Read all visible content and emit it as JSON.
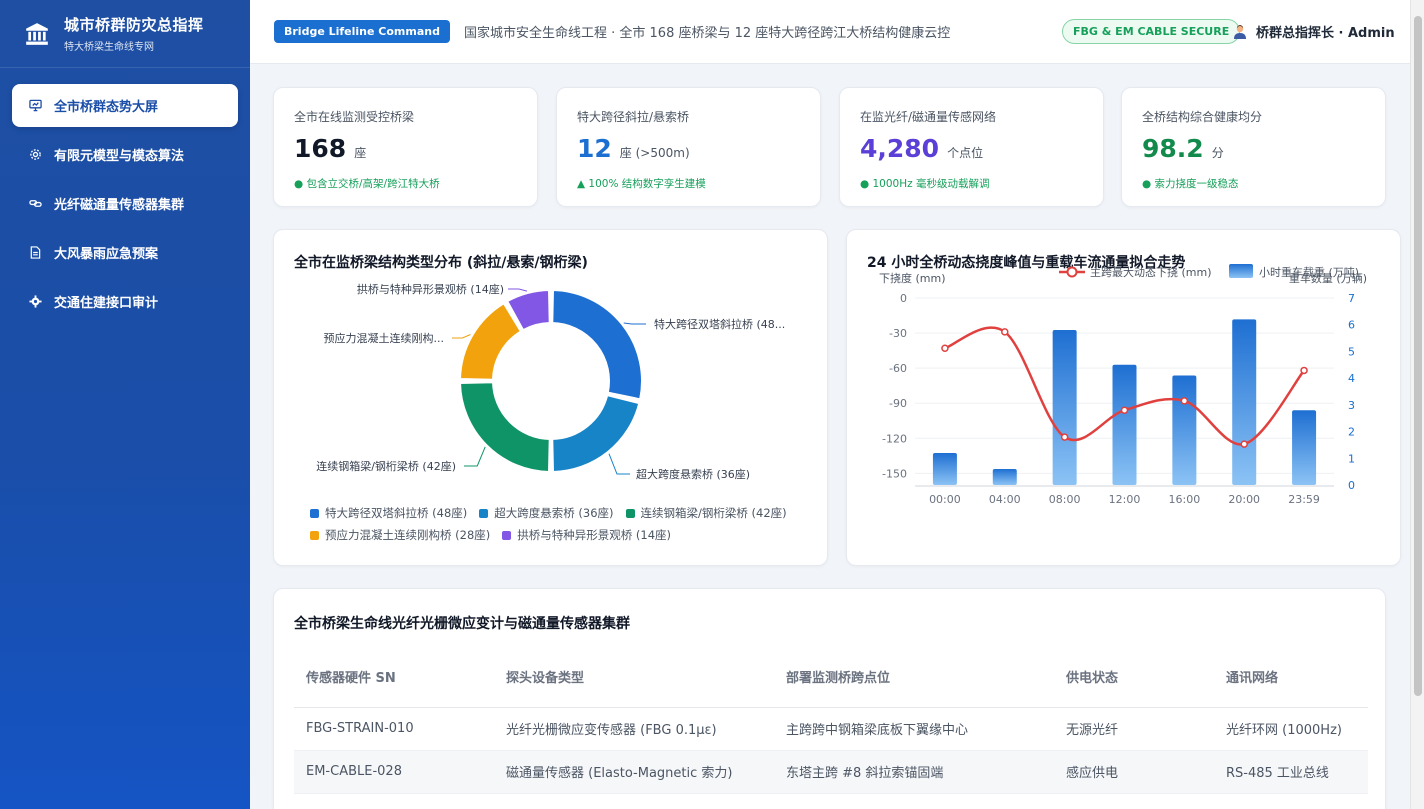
{
  "sidebar": {
    "title": "城市桥群防灾总指挥",
    "subtitle": "特大桥梁生命线专网",
    "items": [
      {
        "label": "全市桥群态势大屏",
        "icon": "dashboard-icon"
      },
      {
        "label": "有限元模型与模态算法",
        "icon": "cog-icon"
      },
      {
        "label": "光纤磁通量传感器集群",
        "icon": "link-icon"
      },
      {
        "label": "大风暴雨应急预案",
        "icon": "document-icon"
      },
      {
        "label": "交通住建接口审计",
        "icon": "gear-icon"
      }
    ]
  },
  "header": {
    "badge": "Bridge Lifeline Command",
    "description": "国家城市安全生命线工程 · 全市 168 座桥梁与 12 座特大跨径跨江大桥结构健康云控",
    "secure_badge": "FBG & EM CABLE SECURE",
    "user": "桥群总指挥长 · Admin"
  },
  "kpis": [
    {
      "label": "全市在线监测受控桥梁",
      "value": "168",
      "unit": "座",
      "foot": "● 包含立交桥/高架/跨江特大桥",
      "color": "#111827"
    },
    {
      "label": "特大跨径斜拉/悬索桥",
      "value": "12",
      "unit": "座 (>500m)",
      "foot": "▲ 100% 结构数字孪生建模",
      "color": "#1a6fd1"
    },
    {
      "label": "在监光纤/磁通量传感网络",
      "value": "4,280",
      "unit": "个点位",
      "foot": "● 1000Hz 毫秒级动载解调",
      "color": "#5b3fd6"
    },
    {
      "label": "全桥结构综合健康均分",
      "value": "98.2",
      "unit": "分",
      "foot": "● 索力挠度一级稳态",
      "color": "#128a4c"
    }
  ],
  "donut": {
    "title": "全市在监桥梁结构类型分布 (斜拉/悬索/钢桁梁)",
    "outer_labels": [
      "特大跨径双塔斜拉桥 (48...",
      "超大跨度悬索桥 (36座)",
      "连续钢箱梁/钢桁梁桥 (42座)",
      "预应力混凝土连续刚构...",
      "拱桥与特种异形景观桥 (14座)"
    ]
  },
  "line_chart": {
    "title": "24 小时全桥动态挠度峰值与重载车流通量拟合走势",
    "left_axis_label": "下挠度 (mm)",
    "right_axis_label": "重车数量 (万辆)",
    "legend_line": "主跨最大动态下挠 (mm)",
    "legend_bar": "小时重车载重 (万吨)"
  },
  "table": {
    "title": "全市桥梁生命线光纤光栅微应变计与磁通量传感器集群",
    "columns": [
      "传感器硬件 SN",
      "探头设备类型",
      "部署监测桥跨点位",
      "供电状态",
      "通讯网络"
    ],
    "rows": [
      [
        "FBG-STRAIN-010",
        "光纤光栅微应变传感器 (FBG 0.1με)",
        "主跨跨中钢箱梁底板下翼缘中心",
        "无源光纤",
        "光纤环网 (1000Hz)"
      ],
      [
        "EM-CABLE-028",
        "磁通量传感器 (Elasto-Magnetic 索力)",
        "东塔主跨 #8 斜拉索锚固端",
        "感应供电",
        "RS-485 工业总线"
      ]
    ]
  },
  "chart_data": [
    {
      "type": "pie",
      "title": "全市在监桥梁结构类型分布 (斜拉/悬索/钢桁梁)",
      "categories": [
        "特大跨径双塔斜拉桥",
        "超大跨度悬索桥",
        "连续钢箱梁/钢桁梁桥",
        "预应力混凝土连续刚构桥",
        "拱桥与特种异形景观桥"
      ],
      "values": [
        48,
        36,
        42,
        28,
        14
      ],
      "colors": [
        "#1e6fd2",
        "#1784c7",
        "#0f9467",
        "#f2a20d",
        "#8257e6"
      ],
      "legend_labels": [
        "特大跨径双塔斜拉桥 (48座)",
        "超大跨度悬索桥 (36座)",
        "连续钢箱梁/钢桁梁桥 (42座)",
        "预应力混凝土连续刚构桥 (28座)",
        "拱桥与特种异形景观桥 (14座)"
      ],
      "legend": "bottom",
      "donut": true
    },
    {
      "type": "bar",
      "title": "24 小时全桥动态挠度峰值与重载车流通量拟合走势",
      "x": [
        "00:00",
        "04:00",
        "08:00",
        "12:00",
        "16:00",
        "20:00",
        "23:59"
      ],
      "series": [
        {
          "name": "主跨最大动态下挠 (mm)",
          "type": "line",
          "axis": "left",
          "color": "#e0413f",
          "values": [
            -43,
            -29,
            -119,
            -96,
            -88,
            -125,
            -62
          ]
        },
        {
          "name": "小时重车载重 (万吨)",
          "type": "bar",
          "axis": "right",
          "color": "#1e6fd2",
          "values": [
            1.2,
            0.6,
            5.8,
            4.5,
            4.1,
            6.2,
            2.8
          ]
        }
      ],
      "ylim_left": [
        -160,
        0
      ],
      "yticks_left": [
        0,
        -30,
        -60,
        -90,
        -120,
        -150
      ],
      "ylim_right": [
        0,
        7
      ],
      "yticks_right": [
        0,
        1,
        2,
        3,
        4,
        5,
        6,
        7
      ],
      "ylabel_left": "下挠度 (mm)",
      "ylabel_right": "重车数量 (万辆)",
      "grid": true,
      "legend": "top"
    }
  ]
}
